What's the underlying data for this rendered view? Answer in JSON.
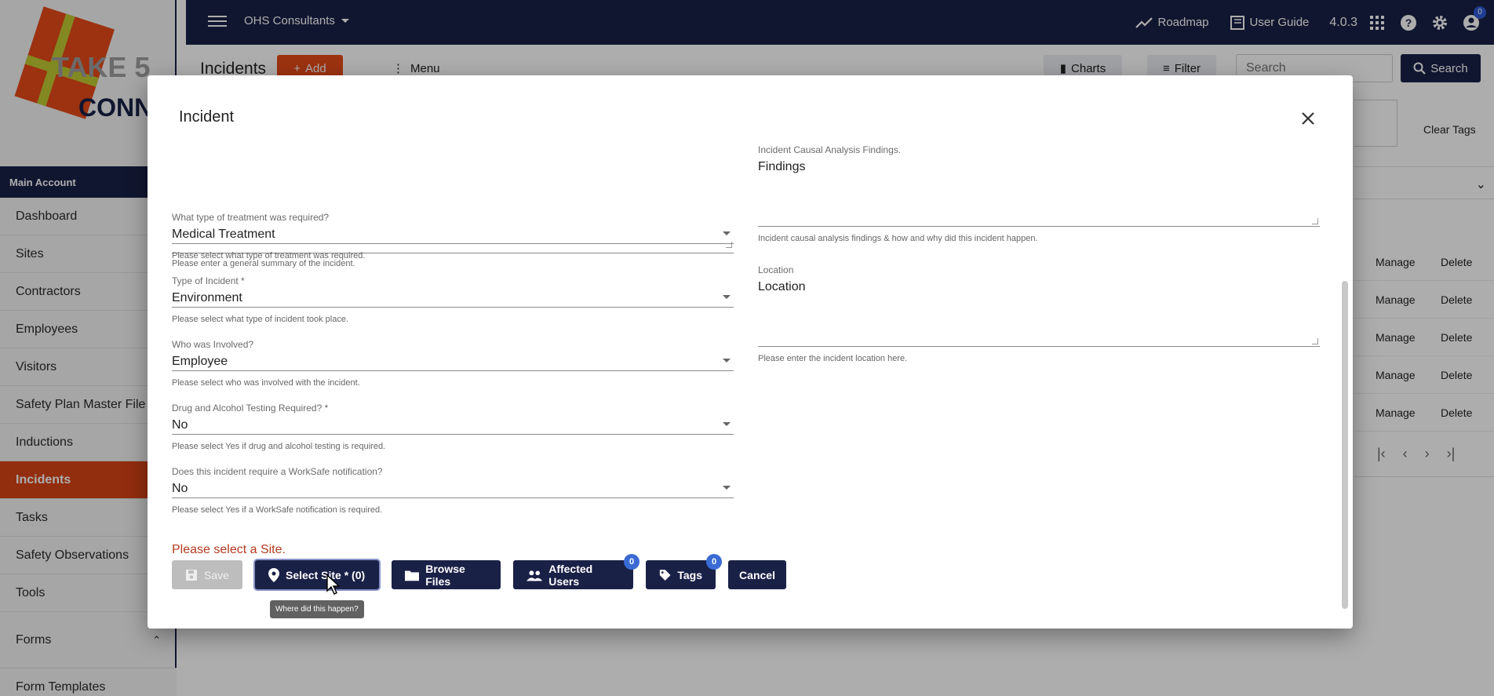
{
  "app": {
    "brand_colors": {
      "navy": "#1a2147",
      "accent": "#d84315",
      "badge": "#3a6bd4"
    }
  },
  "topbar": {
    "org_name": "OHS Consultants",
    "roadmap_label": "Roadmap",
    "user_guide_label": "User Guide",
    "version": "4.0.3",
    "account_badge": "0"
  },
  "sidebar": {
    "logo_text_top": "TAKE 5",
    "logo_text_bottom": "CONNECT",
    "account_header": "Main Account",
    "items": [
      {
        "label": "Dashboard",
        "active": false
      },
      {
        "label": "Sites",
        "active": false
      },
      {
        "label": "Contractors",
        "active": false
      },
      {
        "label": "Employees",
        "active": false
      },
      {
        "label": "Visitors",
        "active": false
      },
      {
        "label": "Safety Plan Master File",
        "active": false
      },
      {
        "label": "Inductions",
        "active": false
      },
      {
        "label": "Incidents",
        "active": true
      },
      {
        "label": "Tasks",
        "active": false
      },
      {
        "label": "Safety Observations",
        "active": false
      },
      {
        "label": "Tools",
        "active": false
      },
      {
        "label": "Forms",
        "active": false
      },
      {
        "label": "Form Templates",
        "active": false
      }
    ]
  },
  "page": {
    "title": "Incidents",
    "add_label": "Add",
    "menu_label": "Menu",
    "charts_label": "Charts",
    "filter_label": "Filter",
    "search_placeholder": "Search",
    "search_button": "Search",
    "clear_tags": "Clear Tags",
    "row_actions": {
      "manage": "Manage",
      "delete": "Delete"
    },
    "row_count": 5
  },
  "dialog": {
    "title": "Incident",
    "fields": {
      "summary_hint": "Please enter a general summary of the incident.",
      "treatment": {
        "label": "What type of treatment was required?",
        "value": "Medical Treatment",
        "hint": "Please select what type of treatment was required."
      },
      "incident_type": {
        "label": "Type of Incident *",
        "value": "Environment",
        "hint": "Please select what type of incident took place."
      },
      "involved": {
        "label": "Who was Involved?",
        "value": "Employee",
        "hint": "Please select who was involved with the incident."
      },
      "drug_testing": {
        "label": "Drug and Alcohol Testing Required? *",
        "value": "No",
        "hint": "Please select Yes if drug and alcohol testing is required."
      },
      "worksafe": {
        "label": "Does this incident require a WorkSafe notification?",
        "value": "No",
        "hint": "Please select Yes if a WorkSafe notification is required."
      },
      "findings": {
        "label": "Incident Causal Analysis Findings.",
        "value": "Findings",
        "hint": "Incident causal analysis findings & how and why did this incident happen."
      },
      "location": {
        "label": "Location",
        "value": "Location",
        "hint": "Please enter the incident location here."
      }
    },
    "site_error": "Please select a Site.",
    "buttons": {
      "save": "Save",
      "select_site": "Select Site * (0)",
      "browse_files": "Browse Files",
      "affected_users": "Affected Users",
      "affected_users_badge": "0",
      "tags": "Tags",
      "tags_badge": "0",
      "cancel": "Cancel"
    },
    "tooltip": "Where did this happen?"
  }
}
